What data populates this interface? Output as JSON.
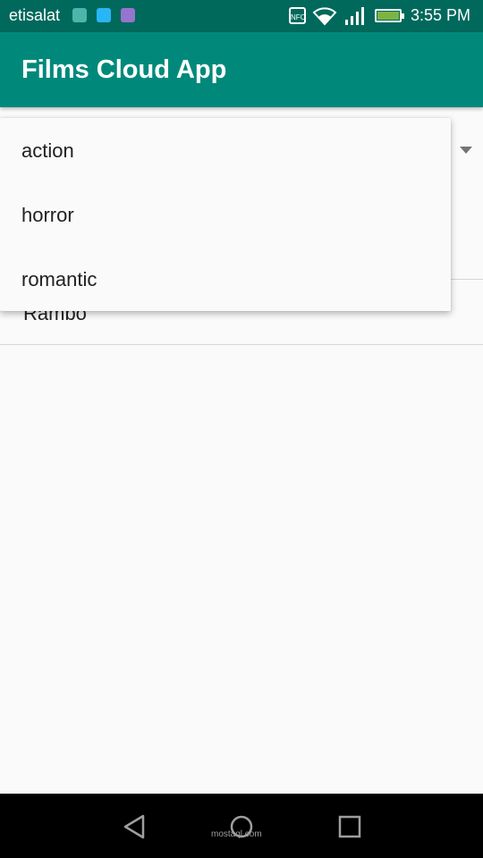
{
  "status_bar": {
    "carrier": "etisalat",
    "time": "3:55 PM",
    "nfc_label": "NFC",
    "notification_icons": [
      "cloud-icon",
      "chat-icon",
      "image-icon"
    ],
    "system_icons": [
      "nfc-icon",
      "wifi-icon",
      "signal-icon",
      "battery-charging-icon"
    ],
    "background_color": "#00695c"
  },
  "app_bar": {
    "title": "Films Cloud App",
    "background_color": "#00897b"
  },
  "spinner": {
    "options": [
      "action",
      "horror",
      "romantic"
    ],
    "expanded": true
  },
  "list": {
    "items": [
      "Rambo"
    ]
  },
  "nav_bar": {
    "buttons": [
      "back-icon",
      "home-icon",
      "recents-icon"
    ],
    "watermark": "mostaql.com"
  }
}
